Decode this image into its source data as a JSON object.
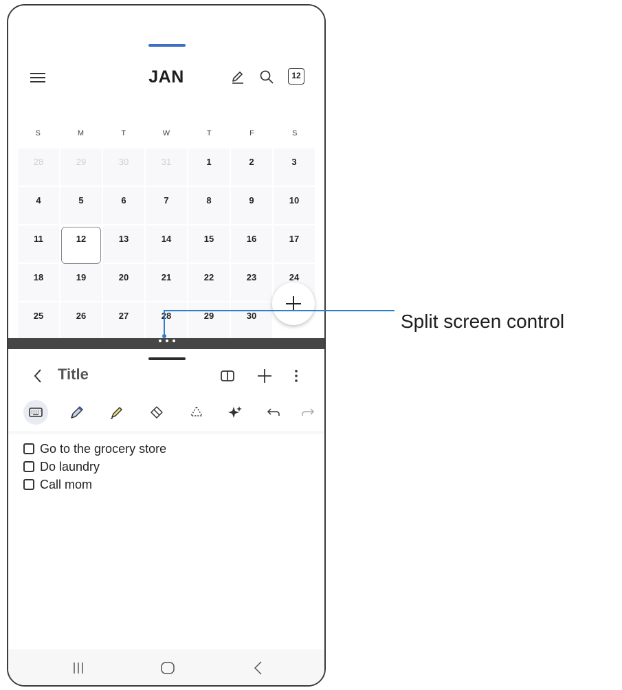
{
  "calendar": {
    "month": "JAN",
    "today_badge": "12",
    "weekdays": [
      "S",
      "M",
      "T",
      "W",
      "T",
      "F",
      "S"
    ],
    "weeks": [
      [
        "28",
        "29",
        "30",
        "31",
        "1",
        "2",
        "3"
      ],
      [
        "4",
        "5",
        "6",
        "7",
        "8",
        "9",
        "10"
      ],
      [
        "11",
        "12",
        "13",
        "14",
        "15",
        "16",
        "17"
      ],
      [
        "18",
        "19",
        "20",
        "21",
        "22",
        "23",
        "24"
      ],
      [
        "25",
        "26",
        "27",
        "28",
        "29",
        "30",
        ""
      ]
    ],
    "muted_days_first_week": 4,
    "selected_day": "12",
    "icons": [
      "menu-icon",
      "pen-edit-icon",
      "search-icon",
      "today-icon",
      "add-icon"
    ]
  },
  "notes": {
    "title": "Title",
    "header_icons": [
      "back-icon",
      "book-view-icon",
      "add-icon",
      "more-icon"
    ],
    "toolbar": [
      "keyboard-icon",
      "pen-icon",
      "highlighter-icon",
      "eraser-icon",
      "lasso-icon",
      "ai-sparkle-icon",
      "undo-icon",
      "redo-icon"
    ],
    "checklist": [
      {
        "text": "Go to the grocery store",
        "checked": false
      },
      {
        "text": "Do laundry",
        "checked": false
      },
      {
        "text": "Call mom",
        "checked": false
      }
    ]
  },
  "navigation": [
    "recents-icon",
    "home-icon",
    "back-icon"
  ],
  "callout": {
    "label": "Split screen control"
  },
  "colors": {
    "accent": "#3f6fc4",
    "callout": "#2d7fc9",
    "divider": "#464646"
  }
}
